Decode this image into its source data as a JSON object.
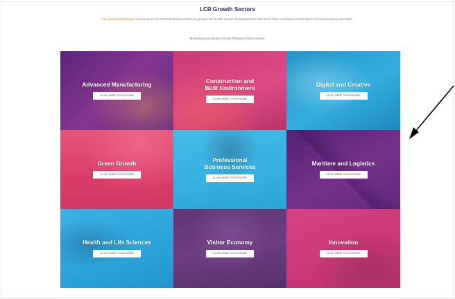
{
  "page": {
    "title": "LCR Growth Sectors",
    "intro_lead": "The Liverpool City Region",
    "intro_rest": " is made up of over 45,000 businesses which are grouped into Growth Sectors. Businesses from each sector have contributed over £30.5bn to the local economy since 2014.",
    "subline": "Businesses are grouped into the following Growth Sectors:"
  },
  "tiles": [
    {
      "label": "Advanced Manufacturing",
      "button": "CLICK HERE TO EXPLORE",
      "color": "#7b2d8e"
    },
    {
      "label": "Construction and\nBuilt Environment",
      "button": "CLICK HERE TO EXPLORE",
      "color": "#d63f7e"
    },
    {
      "label": "Digital and Creative",
      "button": "CLICK HERE TO EXPLORE",
      "color": "#2aa3d6"
    },
    {
      "label": "Green Growth",
      "button": "CLICK HERE TO EXPLORE",
      "color": "#e0456f"
    },
    {
      "label": "Professional\nBusiness Services",
      "button": "CLICK HERE TO EXPLORE",
      "color": "#3bb4e3"
    },
    {
      "label": "Maritime and Logistics",
      "button": "CLICK HERE TO EXPLORE",
      "color": "#6a2a86"
    },
    {
      "label": "Health and Life Sciences",
      "button": "CLICK HERE TO EXPLORE",
      "color": "#2fa9df"
    },
    {
      "label": "Visitor Economy",
      "button": "CLICK HERE TO EXPLORE",
      "color": "#6b3a7a"
    },
    {
      "label": "Innovation",
      "button": "CLICK HERE TO EXPLORE",
      "color": "#d23f7c"
    }
  ],
  "annotation": {
    "arrow_color": "#000000"
  }
}
